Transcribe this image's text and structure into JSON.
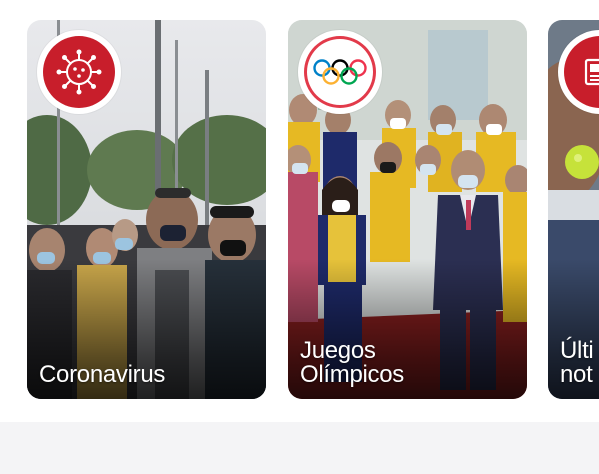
{
  "colors": {
    "accent_red": "#c81e2b",
    "badge_ring": "#e23a4a",
    "page_background": "#f4f4f6",
    "card_text": "#ffffff"
  },
  "carousel": {
    "cards": [
      {
        "label": "Coronavirus",
        "icon": "virus-icon",
        "badge_style": "red"
      },
      {
        "label": "Juegos\nOlímpicos",
        "icon": "olympic-rings-icon",
        "badge_style": "white"
      },
      {
        "label": "Últi\nnot",
        "icon": "newspaper-icon",
        "badge_style": "red"
      }
    ]
  }
}
